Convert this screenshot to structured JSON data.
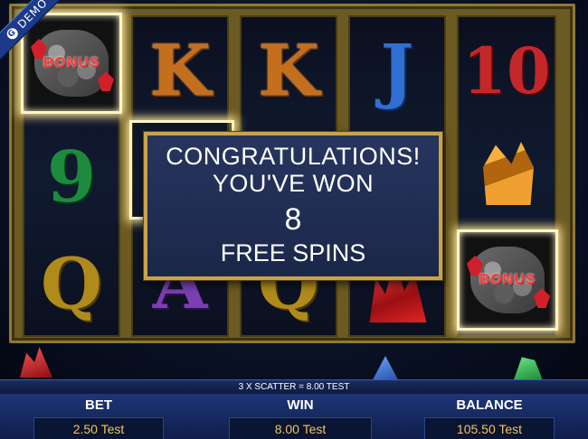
{
  "demo_badge": {
    "label": "DEMO",
    "icon": "g-logo-icon"
  },
  "reels": {
    "reel1": {
      "top": "BONUS",
      "mid": "9",
      "bottom": "Q"
    },
    "reel2": {
      "top": "K",
      "mid": "",
      "bottom": "A"
    },
    "reel3": {
      "top": "K",
      "mid": "",
      "bottom": "Q"
    },
    "reel4": {
      "top": "J",
      "mid": "",
      "bottom": ""
    },
    "reel5": {
      "top": "10",
      "mid": "",
      "bottom": "BONUS"
    }
  },
  "popup": {
    "line1": "CONGRATULATIONS!",
    "line2": "YOU'VE WON",
    "count": "8",
    "line3": "FREE SPINS"
  },
  "scatter_message": "3 X SCATTER = 8.00 TEST",
  "bet": {
    "label": "BET",
    "value": "2.50 Test"
  },
  "win": {
    "label": "WIN",
    "value": "8.00 Test"
  },
  "balance": {
    "label": "BALANCE",
    "value": "105.50 Test"
  },
  "colors": {
    "frame": "#8d7a34",
    "accent_gold": "#c9a24a",
    "value_text": "#f0c45a",
    "panel": "#1e3577"
  }
}
